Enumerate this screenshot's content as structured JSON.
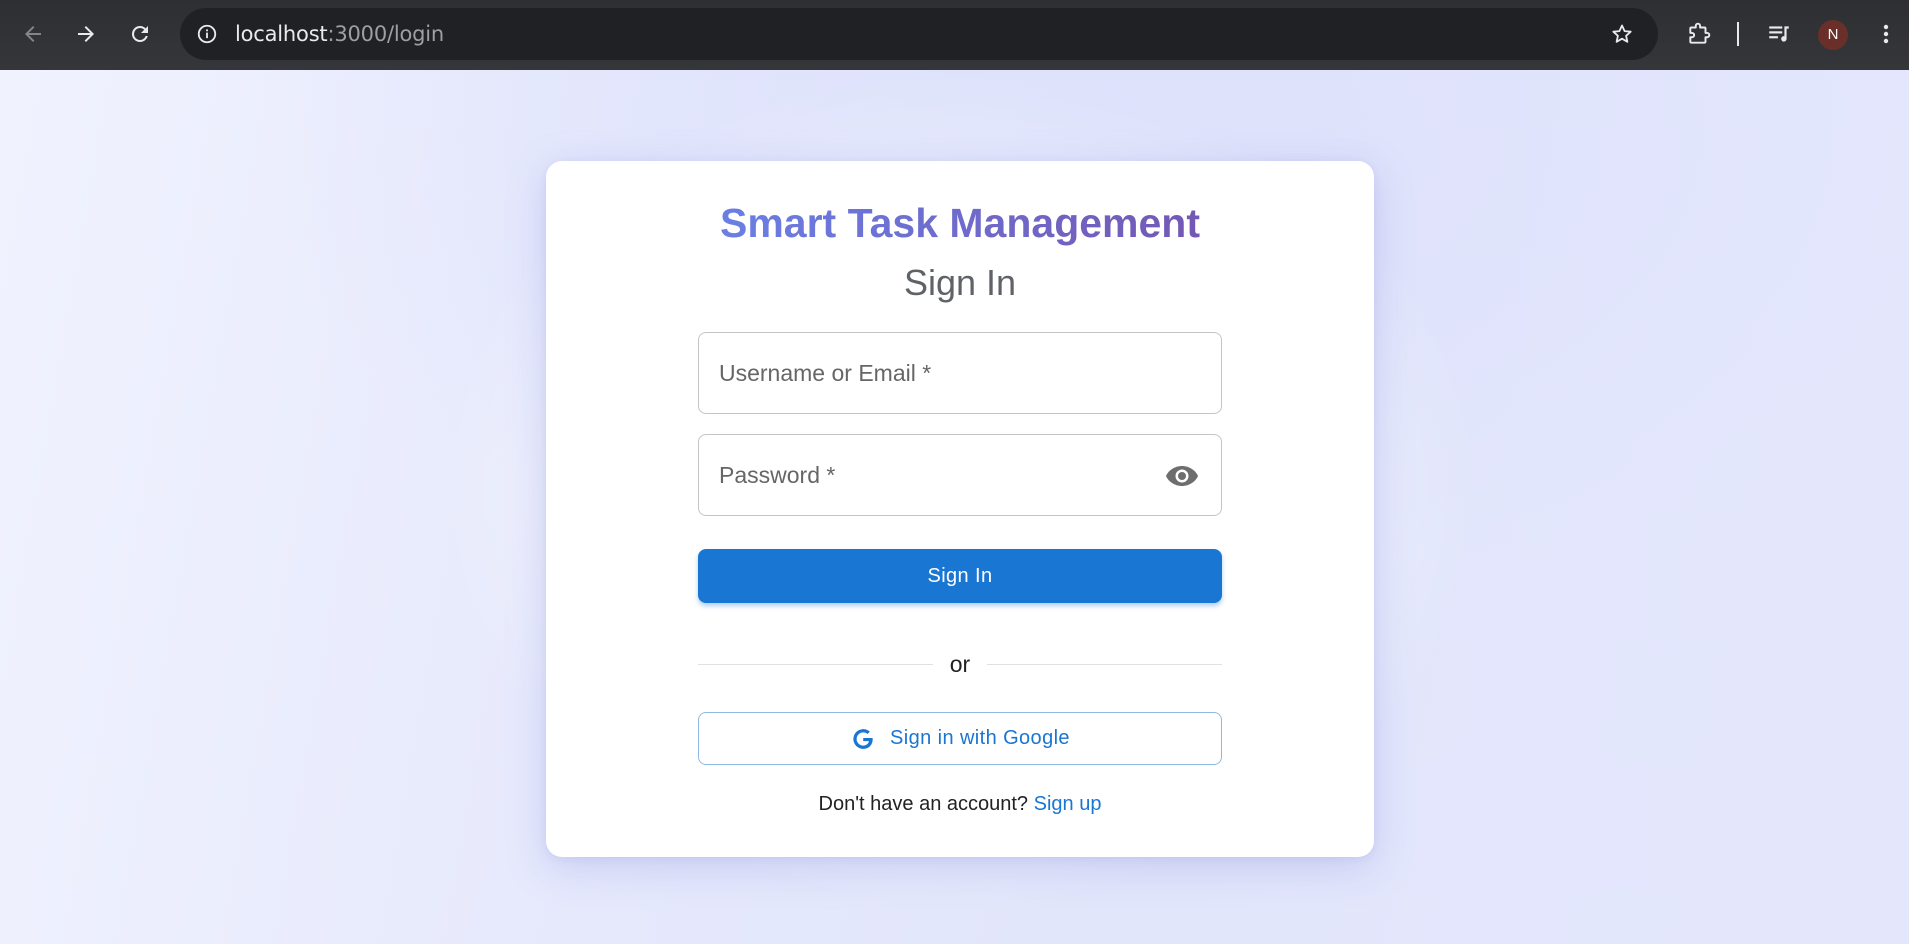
{
  "browser": {
    "url_host": "localhost",
    "url_path": ":3000/login",
    "avatar_initial": "N",
    "icons": {
      "back": "arrow-left-icon",
      "forward": "arrow-right-icon",
      "reload": "reload-icon",
      "site_info": "info-icon",
      "bookmark": "star-icon",
      "extensions": "puzzle-icon",
      "media": "playlist-icon",
      "menu": "kebab-menu-icon"
    }
  },
  "login": {
    "app_title": "Smart Task Management",
    "heading": "Sign In",
    "username_placeholder": "Username or Email *",
    "password_placeholder": "Password *",
    "submit_label": "Sign In",
    "divider_text": "or",
    "google_label": "Sign in with Google",
    "signup_prompt": "Don't have an account?",
    "signup_link": "Sign up"
  },
  "colors": {
    "primary": "#1976d2",
    "title_gradient_start": "#6a7fe4",
    "title_gradient_end": "#7457b4",
    "browser_bar": "#35363a",
    "avatar_bg": "#6b2f2a"
  }
}
